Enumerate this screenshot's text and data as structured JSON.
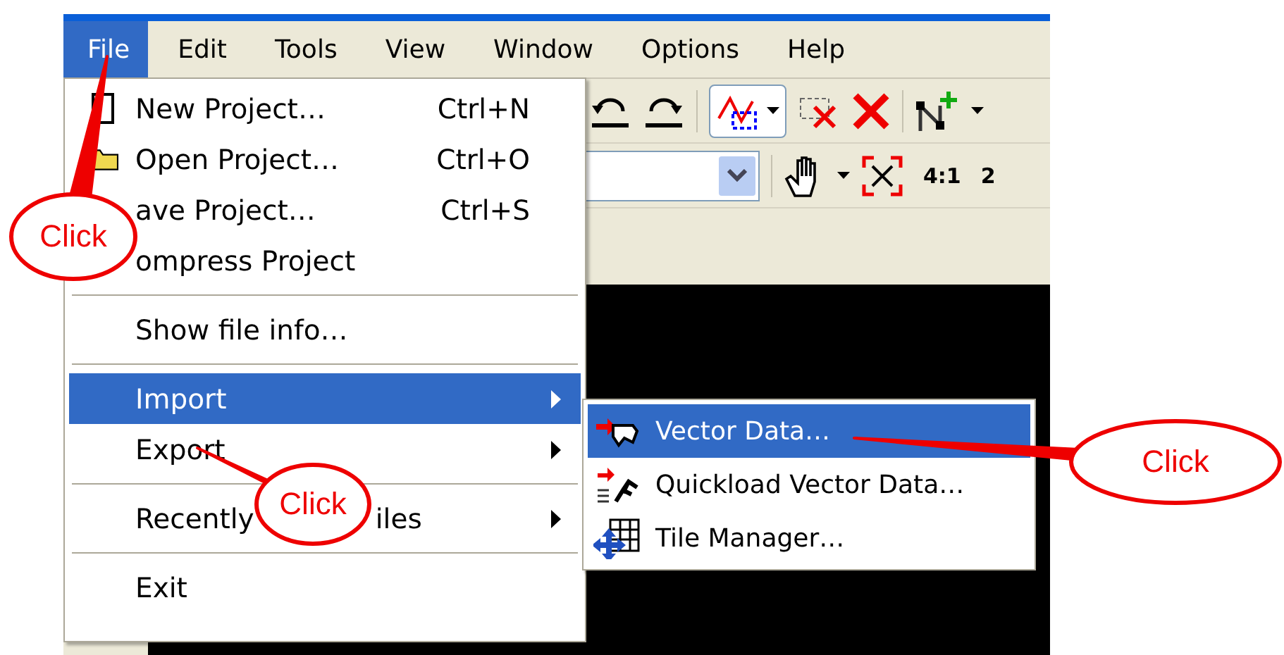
{
  "menu_bar": [
    {
      "label": "File",
      "selected": true
    },
    {
      "label": "Edit",
      "selected": false
    },
    {
      "label": "Tools",
      "selected": false
    },
    {
      "label": "View",
      "selected": false
    },
    {
      "label": "Window",
      "selected": false
    },
    {
      "label": "Options",
      "selected": false
    },
    {
      "label": "Help",
      "selected": false
    }
  ],
  "toolbar": {
    "zoom_ratio": "4:1",
    "next_ratio_cut": "2"
  },
  "file_menu": {
    "items": [
      {
        "kind": "item",
        "label": "New Project…",
        "shortcut": "Ctrl+N",
        "selected": false,
        "submenu": false
      },
      {
        "kind": "item",
        "label": "Open Project…",
        "shortcut": "Ctrl+O",
        "selected": false,
        "submenu": false
      },
      {
        "kind": "item",
        "label": "ave Project…",
        "shortcut": "Ctrl+S",
        "selected": false,
        "submenu": false
      },
      {
        "kind": "item",
        "label": "ompress Project",
        "selected": false,
        "submenu": false
      },
      {
        "kind": "separator"
      },
      {
        "kind": "item",
        "label": "Show file info…",
        "selected": false,
        "submenu": false
      },
      {
        "kind": "separator"
      },
      {
        "kind": "item",
        "label": "Import",
        "selected": true,
        "submenu": true
      },
      {
        "kind": "item",
        "label": "Export",
        "selected": false,
        "submenu": true
      },
      {
        "kind": "separator"
      },
      {
        "kind": "item",
        "label": "Recently",
        "label_tail": "iles",
        "selected": false,
        "submenu": true
      },
      {
        "kind": "separator"
      },
      {
        "kind": "item",
        "label": "Exit",
        "selected": false,
        "submenu": false
      }
    ]
  },
  "import_submenu": {
    "items": [
      {
        "label": "Vector Data…",
        "selected": true
      },
      {
        "label": "Quickload Vector Data…",
        "selected": false
      },
      {
        "label": "Tile Manager…",
        "selected": false
      }
    ]
  },
  "callouts": [
    {
      "text": "Click"
    },
    {
      "text": "Click"
    },
    {
      "text": "Click"
    }
  ]
}
